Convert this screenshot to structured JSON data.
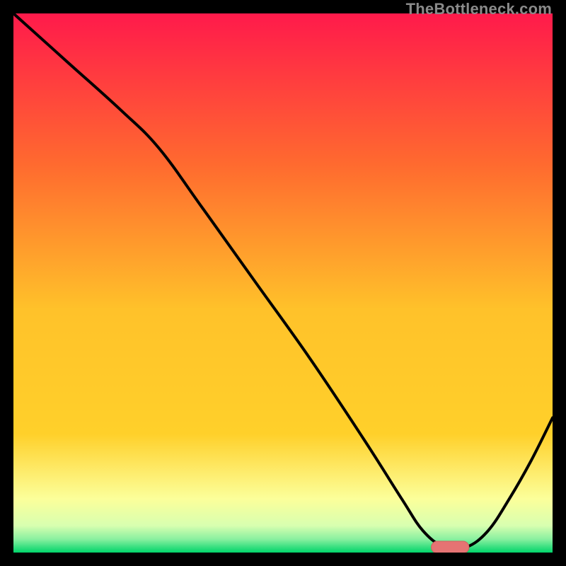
{
  "watermark": "TheBottleneck.com",
  "colors": {
    "top": "#ff1a4b",
    "mid_upper": "#ff7a2a",
    "mid": "#ffd02a",
    "mid_lower": "#fff66a",
    "band_pale": "#f7ffbd",
    "bottom": "#00d46a",
    "curve": "#000000",
    "marker_fill": "#e57373",
    "marker_stroke": "#d16060"
  },
  "chart_data": {
    "type": "line",
    "title": "",
    "xlabel": "",
    "ylabel": "",
    "xlim": [
      0,
      100
    ],
    "ylim": [
      0,
      100
    ],
    "grid": false,
    "legend": false,
    "series": [
      {
        "name": "bottleneck-curve",
        "x": [
          0,
          10,
          20,
          27,
          35,
          45,
          55,
          65,
          72,
          76,
          80,
          84,
          88,
          92,
          96,
          100
        ],
        "y": [
          100,
          91,
          82,
          75,
          64,
          50,
          36,
          21,
          10,
          4,
          1,
          1,
          4,
          10,
          17,
          25
        ]
      }
    ],
    "marker": {
      "x": 81,
      "y": 1,
      "width": 7,
      "height": 2.2,
      "rx": 1.1
    }
  }
}
